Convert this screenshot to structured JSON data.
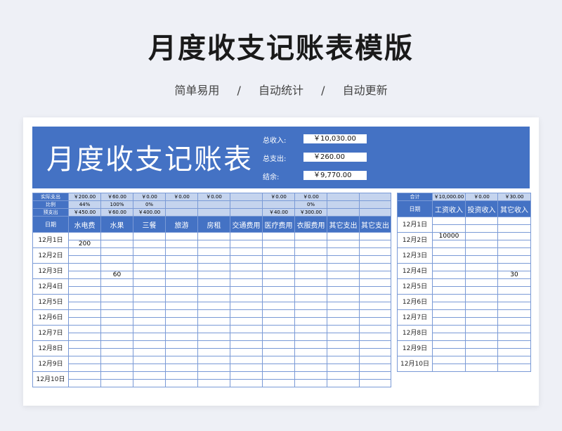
{
  "page": {
    "title": "月度收支记账表模版",
    "subtitle": [
      "简单易用",
      "/",
      "自动统计",
      "/",
      "自动更新"
    ]
  },
  "banner": {
    "title": "月度收支记账表",
    "summary": [
      {
        "label": "总收入:",
        "value": "￥10,030.00"
      },
      {
        "label": "总支出:",
        "value": "￥260.00"
      },
      {
        "label": "结余:",
        "value": "￥9,770.00"
      }
    ]
  },
  "expense": {
    "summary_rows": [
      {
        "label": "实际支出",
        "cells": [
          "￥200.00",
          "￥60.00",
          "￥0.00",
          "￥0.00",
          "￥0.00",
          "",
          "￥0.00",
          "￥0.00",
          "",
          ""
        ]
      },
      {
        "label": "比例",
        "cells": [
          "44%",
          "100%",
          "0%",
          "",
          "",
          "",
          "",
          "0%",
          "",
          ""
        ]
      },
      {
        "label": "预支出",
        "cells": [
          "￥450.00",
          "￥60.00",
          "￥400.00",
          "",
          "",
          "",
          "￥40.00",
          "￥300.00",
          "",
          ""
        ]
      }
    ],
    "headers": [
      "日期",
      "水电费",
      "水果",
      "三餐",
      "旅游",
      "房租",
      "交通费用",
      "医疗费用",
      "衣服费用",
      "其它支出",
      "其它支出"
    ],
    "dates": [
      "12月1日",
      "12月2日",
      "12月3日",
      "12月4日",
      "12月5日",
      "12月6日",
      "12月7日",
      "12月8日",
      "12月9日",
      "12月10日"
    ],
    "entries": [
      {
        "sub_row": 1,
        "col": 1,
        "value": "200"
      },
      {
        "sub_row": 5,
        "col": 2,
        "value": "60"
      }
    ]
  },
  "income": {
    "total_label": "合计",
    "totals": [
      "￥10,000.00",
      "￥0.00",
      "￥30.00"
    ],
    "headers": [
      "日期",
      "工资收入",
      "投资收入",
      "其它收入"
    ],
    "dates": [
      "12月1日",
      "12月2日",
      "12月3日",
      "12月4日",
      "12月5日",
      "12月6日",
      "12月7日",
      "12月8日",
      "12月9日",
      "12月10日"
    ],
    "entries": [
      {
        "sub_row": 2,
        "col": 1,
        "value": "10000"
      },
      {
        "sub_row": 7,
        "col": 3,
        "value": "30"
      }
    ]
  },
  "colors": {
    "accent": "#4472c4",
    "light": "#c5d4ee",
    "grid": "#7a9ad6"
  }
}
